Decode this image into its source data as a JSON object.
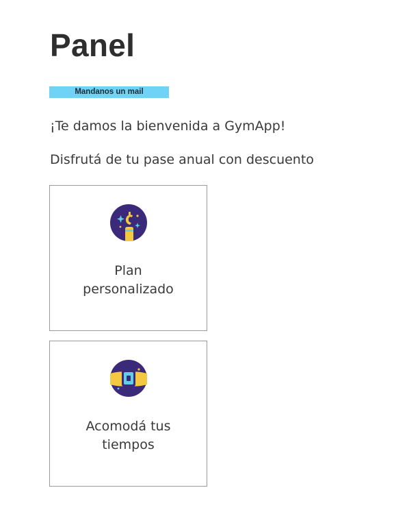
{
  "header": {
    "title": "Panel"
  },
  "badge": {
    "label": "Mandanos un mail",
    "color": "#6fd3f5"
  },
  "messages": {
    "welcome": "¡Te damos la bienvenida a GymApp!",
    "promo": "Disfrutá de tu pase anual con descuento"
  },
  "cards": [
    {
      "label_line1": "Plan",
      "label_line2": "personalizado",
      "icon": "magic-plan-icon"
    },
    {
      "label_line1": "Acomodá tus",
      "label_line2": "tiempos",
      "icon": "smartwatch-icon"
    }
  ],
  "colors": {
    "icon_background": "#3b2a7a",
    "icon_accent": "#f5c842",
    "icon_sparkle": "#5fd0e8"
  }
}
